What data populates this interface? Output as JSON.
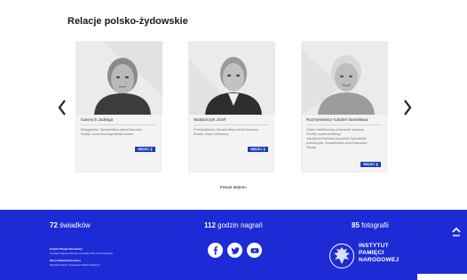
{
  "section": {
    "title": "Relacje polsko-żydowskie"
  },
  "cards": [
    {
      "name": "Gawrych Jadwiga",
      "desc": [
        "Pielęgniarka, Sprawiedliwa wśród Narodów",
        "Świata, honorowa obywatelka Izraela."
      ],
      "more": "WIĘCEJ ❯"
    },
    {
      "name": "Walaszczyk Józef",
      "desc": [
        "Przedsiębiorca, Sprawiedliwy wśród Narodów",
        "Świata, mistrz kaletniczy."
      ],
      "more": "WIĘCEJ ❯"
    },
    {
      "name": "Rozmysłowicz-Szlubel Stanisława",
      "desc": [
        "Doktor habilitowana, pracownik naukowy",
        "SGGW, szabla krótkiego",
        "współprzechowania ukrywania Żydowskiej",
        "dziewczynki, Sprawiedliwa wśród Narodów",
        "Świata."
      ],
      "more": "WIĘCEJ ❯"
    }
  ],
  "show_more": "POKAŻ WIĘCEJ",
  "footer": {
    "stats": [
      {
        "num": "72",
        "label": "świadków"
      },
      {
        "num": "112",
        "label": "godzin nagrań"
      },
      {
        "num": "85",
        "label": "fotografii"
      }
    ],
    "notes": [
      "Instytut Pamięci Narodowej",
      "Komisja Ścigania Zbrodni przeciwko Narodowi Polskiemu",
      "Biuro Edukacji Narodowej",
      "Wydział Notacji i Opracowań Multimedialnych"
    ],
    "ipn": [
      "INSTYTUT",
      "PAMIĘCI",
      "NARODOWEJ"
    ]
  },
  "colors": {
    "footer": "#1d2bd6",
    "button": "#1a3fb8"
  },
  "icons": [
    "chevron-left-icon",
    "chevron-right-icon",
    "facebook-icon",
    "twitter-icon",
    "youtube-icon",
    "ipn-eagle-emblem",
    "chevron-up-icon"
  ]
}
